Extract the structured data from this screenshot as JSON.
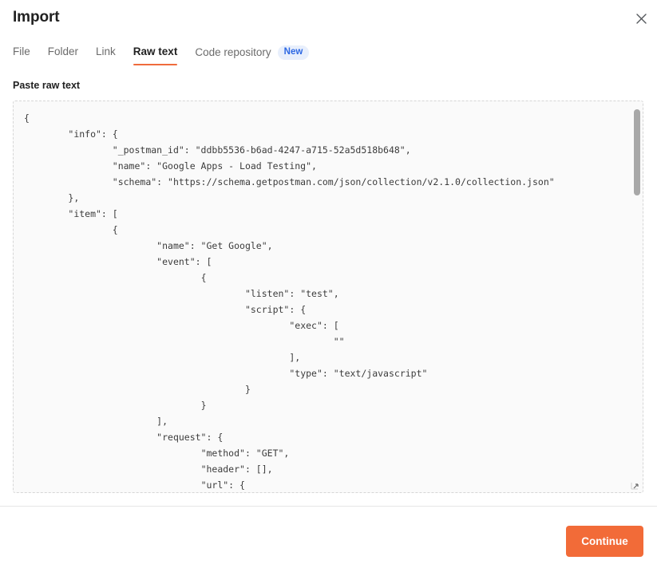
{
  "header": {
    "title": "Import",
    "close_icon": "close-icon"
  },
  "tabs": [
    {
      "label": "File",
      "active": false,
      "badge": null
    },
    {
      "label": "Folder",
      "active": false,
      "badge": null
    },
    {
      "label": "Link",
      "active": false,
      "badge": null
    },
    {
      "label": "Raw text",
      "active": true,
      "badge": null
    },
    {
      "label": "Code repository",
      "active": false,
      "badge": "New"
    }
  ],
  "raw_text_field": {
    "label": "Paste raw text",
    "placeholder": "Paste raw text",
    "value": "{\n\t\"info\": {\n\t\t\"_postman_id\": \"ddbb5536-b6ad-4247-a715-52a5d518b648\",\n\t\t\"name\": \"Google Apps - Load Testing\",\n\t\t\"schema\": \"https://schema.getpostman.com/json/collection/v2.1.0/collection.json\"\n\t},\n\t\"item\": [\n\t\t{\n\t\t\t\"name\": \"Get Google\",\n\t\t\t\"event\": [\n\t\t\t\t{\n\t\t\t\t\t\"listen\": \"test\",\n\t\t\t\t\t\"script\": {\n\t\t\t\t\t\t\"exec\": [\n\t\t\t\t\t\t\t\"\"\n\t\t\t\t\t\t],\n\t\t\t\t\t\t\"type\": \"text/javascript\"\n\t\t\t\t\t}\n\t\t\t\t}\n\t\t\t],\n\t\t\t\"request\": {\n\t\t\t\t\"method\": \"GET\",\n\t\t\t\t\"header\": [],\n\t\t\t\t\"url\": {"
  },
  "footer": {
    "continue_label": "Continue"
  },
  "colors": {
    "accent_orange": "#f26b38",
    "tab_underline": "#ef6b3c",
    "badge_bg": "#e8effc",
    "badge_text": "#2d68e3",
    "textarea_bg": "#fafafa"
  }
}
